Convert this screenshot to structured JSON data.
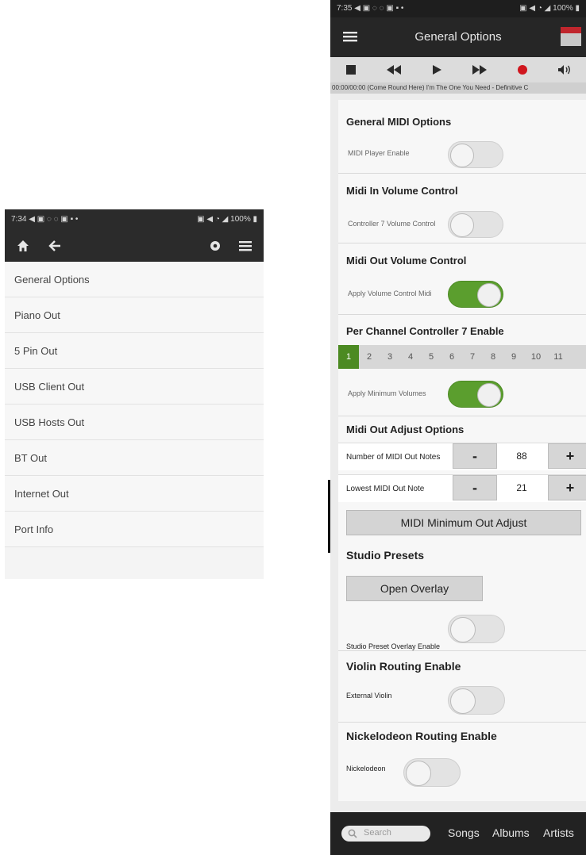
{
  "left": {
    "status_time": "7:34 ◀ ▣ ◌ ◌ ▣ ▪ •",
    "status_right": "▣ ◀ ◔ ◢ 100% ▮",
    "items": [
      {
        "label": "General Options"
      },
      {
        "label": "Piano Out"
      },
      {
        "label": "5 Pin Out"
      },
      {
        "label": "USB Client Out"
      },
      {
        "label": "USB Hosts Out"
      },
      {
        "label": "BT Out"
      },
      {
        "label": "Internet Out"
      },
      {
        "label": "Port Info"
      }
    ]
  },
  "right": {
    "status_time": "7:35 ◀ ▣ ◌ ◌ ▣ ▪ •",
    "status_right": "▣ ◀ ◔ ◢ 100% ▮",
    "title": "General Options",
    "ticker": "00:00/00:00 (Come Round Here) I'm The One You Need - Definitive C",
    "general_midi": {
      "title": "General MIDI Options",
      "label": "MIDI Player Enable"
    },
    "midi_in_volume": {
      "title": "Midi In Volume Control",
      "label": "Controller 7 Volume Control"
    },
    "midi_out_volume": {
      "title": "Midi Out Volume Control",
      "label": "Apply Volume Control Midi"
    },
    "per_channel": {
      "title": "Per Channel Controller 7 Enable",
      "channels": [
        "1",
        "2",
        "3",
        "4",
        "5",
        "6",
        "7",
        "8",
        "9",
        "10",
        "11"
      ],
      "label": "Apply Minimum Volumes"
    },
    "midi_out_adjust": {
      "title": "Midi Out Adjust Options",
      "notes_label": "Number of MIDI Out Notes",
      "notes_value": "88",
      "lowest_label": "Lowest MIDI Out Note",
      "lowest_value": "21",
      "minus": "-",
      "plus": "+",
      "min_adjust_button": "MIDI Minimum Out Adjust"
    },
    "studio_presets": {
      "title": "Studio Presets",
      "open_overlay_button": "Open Overlay",
      "overlay_label": "Studio Preset Overlay Enable"
    },
    "violin": {
      "title": "Violin Routing Enable",
      "label": "External Violin"
    },
    "nickelodeon": {
      "title": "Nickelodeon Routing Enable",
      "label": "Nickelodeon"
    },
    "bottom": {
      "search_placeholder": "Search",
      "tabs": [
        "Songs",
        "Albums",
        "Artists"
      ]
    }
  }
}
